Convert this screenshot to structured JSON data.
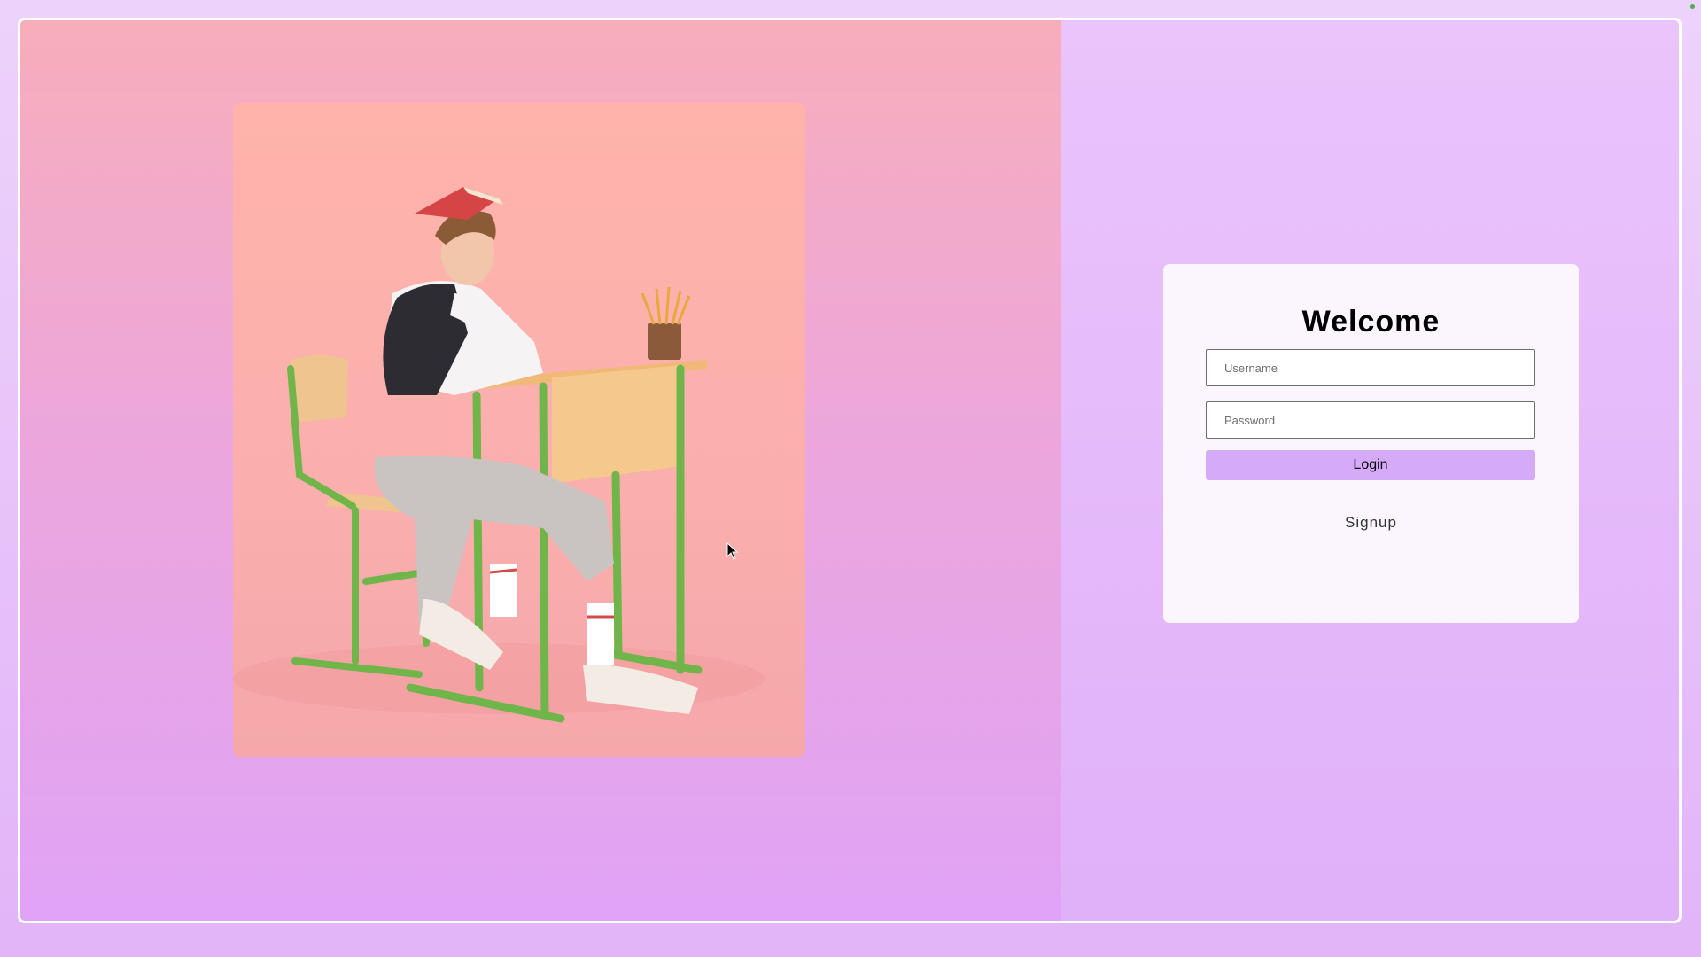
{
  "login": {
    "title": "Welcome",
    "username_placeholder": "Username",
    "password_placeholder": "Password",
    "login_label": "Login",
    "signup_label": "Signup"
  },
  "colors": {
    "page_background": "#e8c2fa",
    "left_panel": "#efa8cf",
    "card_background": "#fbf5fd",
    "login_button": "#d5aaf7",
    "status_dot": "#4caf50"
  },
  "icons": {
    "cursor": "mouse-pointer-icon",
    "status": "status-dot-icon"
  }
}
